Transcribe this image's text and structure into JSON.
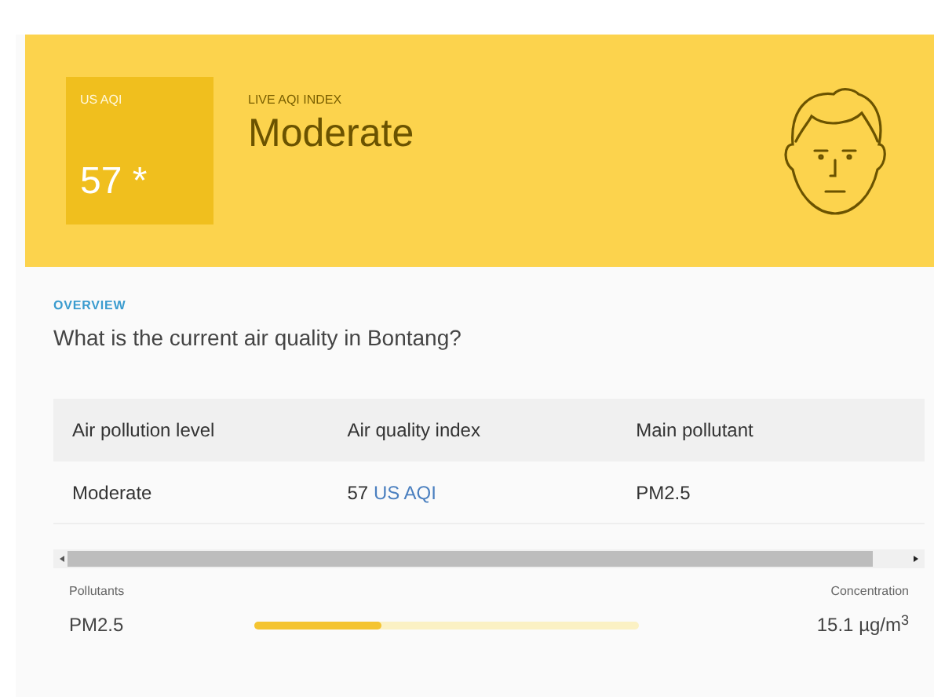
{
  "header": {
    "badge_label": "US AQI",
    "badge_value": "57",
    "badge_star": "*",
    "eyebrow": "LIVE AQI INDEX",
    "status": "Moderate"
  },
  "overview": {
    "eyebrow": "OVERVIEW",
    "question": "What is the current air quality in Bontang?"
  },
  "table": {
    "columns": [
      "Air pollution level",
      "Air quality index",
      "Main pollutant"
    ],
    "rows": [
      [
        "Moderate",
        "57",
        "PM2.5"
      ]
    ],
    "index_unit": "US AQI"
  },
  "pollutants": {
    "label": "Pollutants",
    "concentration_label": "Concentration",
    "items": [
      {
        "name": "PM2.5",
        "level": 0.33,
        "value": "15.1 µg/m$^{3}$"
      }
    ]
  }
}
